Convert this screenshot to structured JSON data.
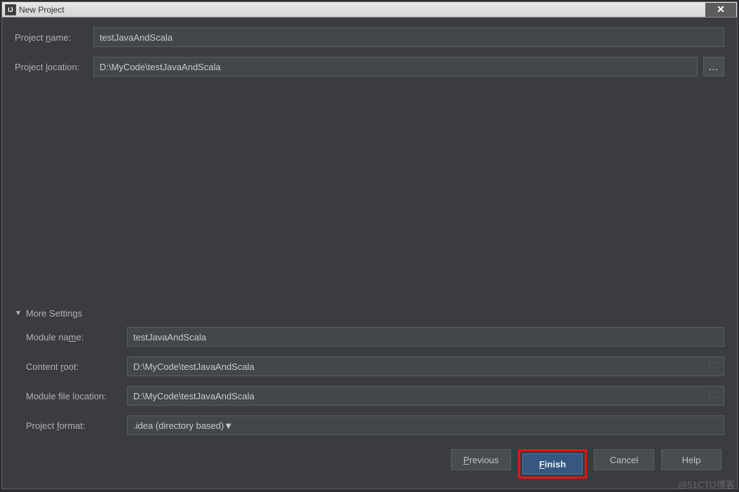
{
  "window": {
    "title": "New Project"
  },
  "fields": {
    "projectName": {
      "label": "Project name:",
      "value": "testJavaAndScala"
    },
    "projectLocation": {
      "label": "Project location:",
      "value": "D:\\MyCode\\testJavaAndScala"
    }
  },
  "moreSettings": {
    "header": "More Settings",
    "moduleName": {
      "label": "Module name:",
      "value": "testJavaAndScala"
    },
    "contentRoot": {
      "label": "Content root:",
      "value": "D:\\MyCode\\testJavaAndScala"
    },
    "moduleFileLocation": {
      "label": "Module file location:",
      "value": "D:\\MyCode\\testJavaAndScala"
    },
    "projectFormat": {
      "label": "Project format:",
      "value": ".idea (directory based)"
    }
  },
  "buttons": {
    "browse": "...",
    "previous": "Previous",
    "finish": "Finish",
    "cancel": "Cancel",
    "help": "Help"
  },
  "watermark": "@51CTO博客"
}
